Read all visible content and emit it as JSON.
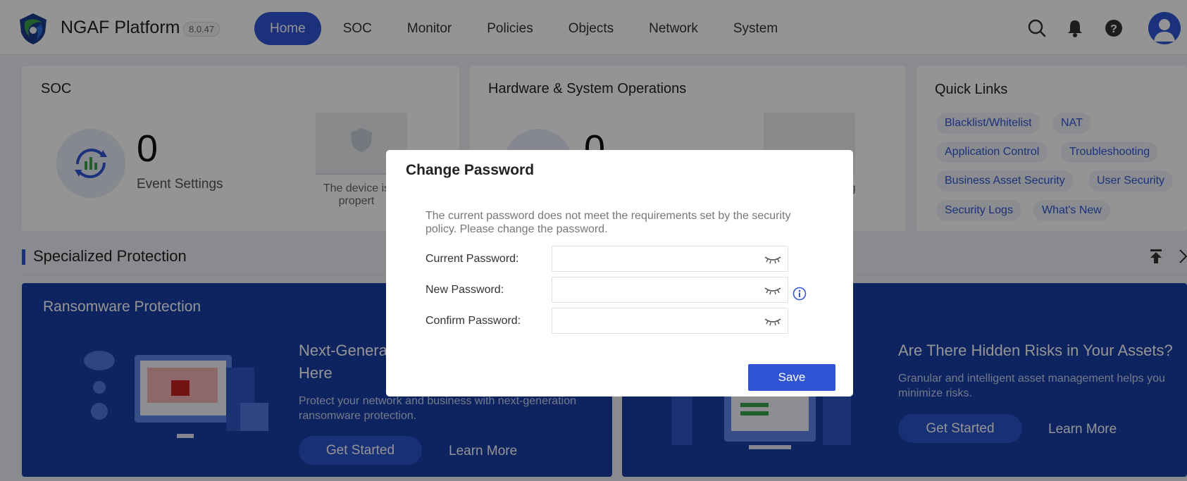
{
  "app": {
    "title": "NGAF Platform",
    "version": "8.0.47"
  },
  "nav": {
    "items": [
      {
        "label": "Home",
        "active": true
      },
      {
        "label": "SOC"
      },
      {
        "label": "Monitor"
      },
      {
        "label": "Policies"
      },
      {
        "label": "Objects"
      },
      {
        "label": "Network"
      },
      {
        "label": "System"
      }
    ],
    "icons": [
      "search-icon",
      "bell-icon",
      "help-icon",
      "user-avatar-icon"
    ]
  },
  "soc": {
    "title": "SOC",
    "count": "0",
    "label": "Event Settings",
    "status_text_line1": "The device is",
    "status_text_line2": "propert"
  },
  "hardware": {
    "title": "Hardware & System Operations",
    "count": "0",
    "status_text": "rking"
  },
  "quick_links": {
    "title": "Quick Links",
    "items": [
      "Blacklist/Whitelist",
      "NAT",
      "Application Control",
      "Troubleshooting",
      "Business Asset Security",
      "User Security",
      "Security Logs",
      "What's New"
    ]
  },
  "specialized": {
    "title": "Specialized Protection",
    "ransomware": {
      "title": "Ransomware Protection",
      "headline_line1": "Next-Genera",
      "headline_line2": "Here",
      "desc_line1": "Protect your network and business with next-generation",
      "desc_line2": "ransomware protection.",
      "get_started": "Get Started",
      "learn_more": "Learn More"
    },
    "assets": {
      "headline": "Are There Hidden Risks in Your Assets?",
      "desc_line1": "Granular and intelligent asset management helps you",
      "desc_line2": "minimize risks.",
      "get_started": "Get Started",
      "learn_more": "Learn More"
    }
  },
  "modal": {
    "title": "Change Password",
    "message": "The current password does not meet the requirements set by the security policy. Please change the password.",
    "fields": [
      {
        "label": "Current Password:",
        "value": ""
      },
      {
        "label": "New Password:",
        "value": ""
      },
      {
        "label": "Confirm Password:",
        "value": ""
      }
    ],
    "save_label": "Save"
  },
  "colors": {
    "accent": "#2f55d4",
    "card_blue": "#173ea7"
  }
}
